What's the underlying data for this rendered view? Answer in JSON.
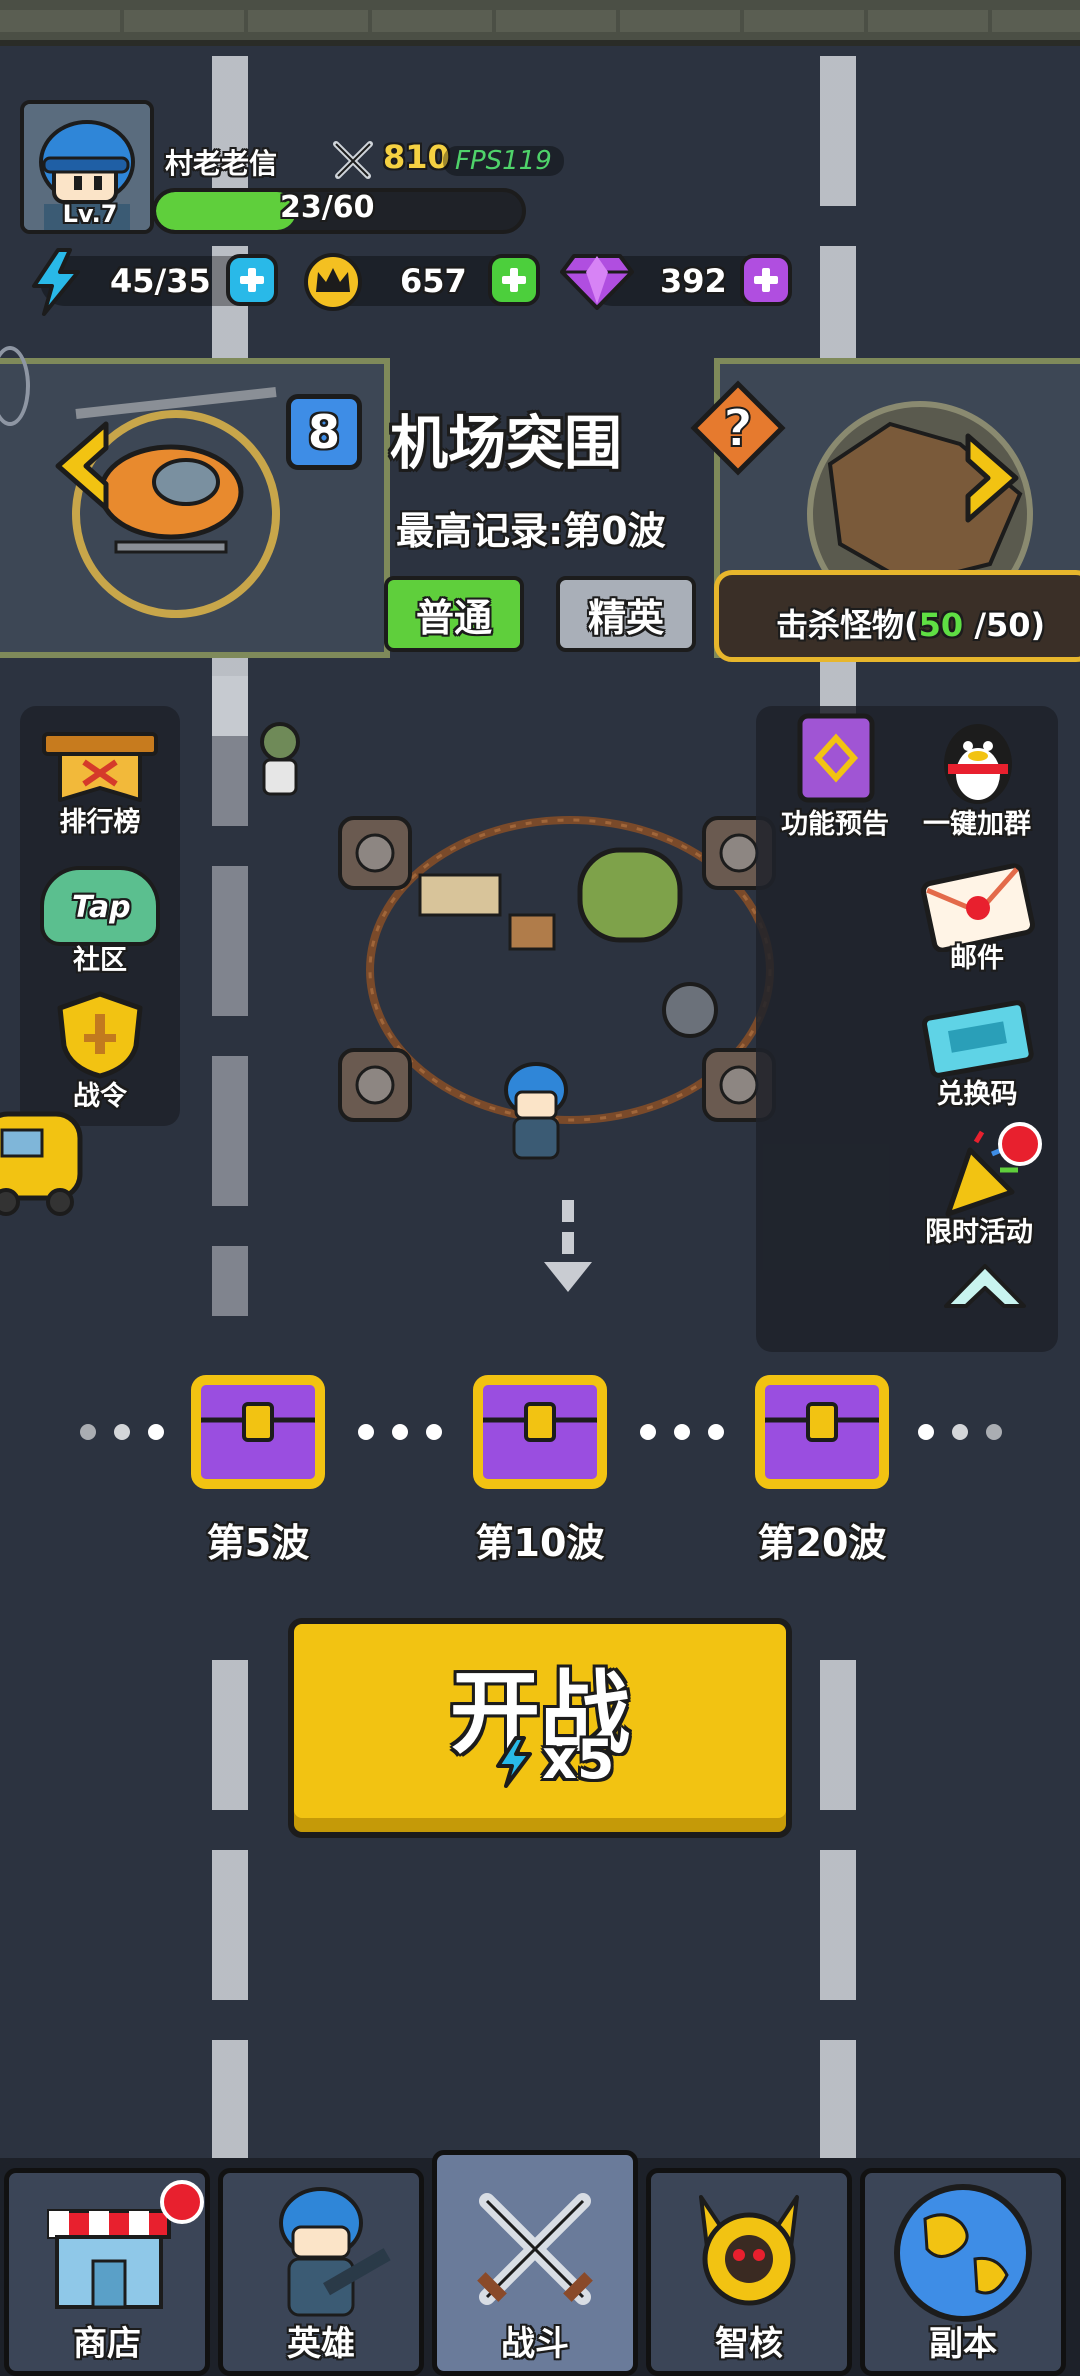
{
  "player": {
    "name": "村老老信",
    "level": "Lv.7",
    "power": "810",
    "fps": "FPS119",
    "xp": "23/60",
    "xp_fraction": 0.3833
  },
  "resources": {
    "energy": "45/35",
    "crown": "657",
    "gem": "392"
  },
  "stage": {
    "number": "8",
    "title": "机场突围",
    "record": "最高记录:第0波",
    "tabs": [
      "普通",
      "精英"
    ],
    "kill_label": "击杀怪物(",
    "kill_current": "50",
    "kill_total": " /50)"
  },
  "left_menu": [
    "排行榜",
    "Tap",
    "社区",
    "战令"
  ],
  "right_menu": [
    "功能预告",
    "一键加群",
    "邮件",
    "兑换码",
    "限时活动"
  ],
  "waves": [
    "第5波",
    "第10波",
    "第20波"
  ],
  "start": {
    "label": "开战",
    "cost": "x5"
  },
  "nav": [
    "商店",
    "英雄",
    "战斗",
    "智核",
    "副本"
  ],
  "colors": {
    "accent_yellow": "#f2c312",
    "xp_green": "#5fcf3c",
    "energy_blue": "#29b9e8",
    "gem_purple": "#b04ee0",
    "crown_gold": "#f4c021"
  }
}
